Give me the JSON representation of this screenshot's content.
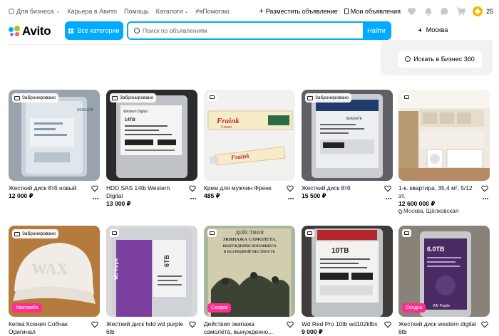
{
  "topbar": {
    "for_business": "Для бизнеса",
    "career": "Карьера в Авито",
    "help": "Помощь",
    "catalogs": "Каталоги",
    "help_tag": "#яПомогаю",
    "post_ad": "Разместить объявление",
    "my_ads": "Мои объявления",
    "coins": "25"
  },
  "header": {
    "logo": "Avito",
    "all_categories": "Все категории",
    "search_placeholder": "Поиск по объявлениям",
    "search_button": "Найти",
    "location": "Москва"
  },
  "business": {
    "search_button": "Искать в Бизнес 360"
  },
  "listings": [
    {
      "title": "Жесткий диск 8тб новый",
      "price": "12 000 ₽",
      "badge": "Забронировано"
    },
    {
      "title": "HDD SAS 14tb Western Digital",
      "price": "13 000 ₽",
      "badge": "Забронировано"
    },
    {
      "title": "Крем для мужчин Френк",
      "price": "485 ₽",
      "badge": ""
    },
    {
      "title": "Жесткий диск 8тб",
      "price": "15 500 ₽",
      "badge": "Забронировано"
    },
    {
      "title": "1-к. квартира, 35,4 м², 5/12 эт.",
      "price": "12 600 000 ₽",
      "badge": "",
      "address": "Москва, Щёлковская"
    },
    {
      "title": "Кепка Ксения Собчак Оригинал",
      "price": "",
      "badge": "Забронировано",
      "promo": "Хватамба"
    },
    {
      "title": "Жесткий диск hdd wd purple 6tb",
      "price": "",
      "badge": ""
    },
    {
      "title": "Действия экипажа самолёта, вынужденно...",
      "price": "",
      "badge": "",
      "promo": "Скидка"
    },
    {
      "title": "Wd Red Pro 10tb wd102kfbx",
      "price": "9 000 ₽",
      "badge": ""
    },
    {
      "title": "Жесткий диск western digital 6tb",
      "price": "",
      "badge": "",
      "promo": "Скидка"
    }
  ],
  "photo_text": {
    "hdd_brand": "SEAGATE",
    "wd_brand": "Western Digital",
    "hdd_14": "14TB",
    "frank_1": "Fraink",
    "frank_2": "Fraink",
    "frank_sub": "Cream",
    "book_1": "ДЕЙСТВИЯ",
    "book_2": "ЭКИПАЖА САМОЛЕТА,",
    "book_3": "ВЫНУЖДЕННО ПОПАВШЕГО",
    "book_4": "В БЕЗЛЮДНОЙ МЕСТНОСТЬ",
    "cap_text": "WAX",
    "wd_purple": "WD Purple",
    "tb6": "6TB",
    "tb10": "10TB",
    "tb6b": "6.0TB"
  }
}
